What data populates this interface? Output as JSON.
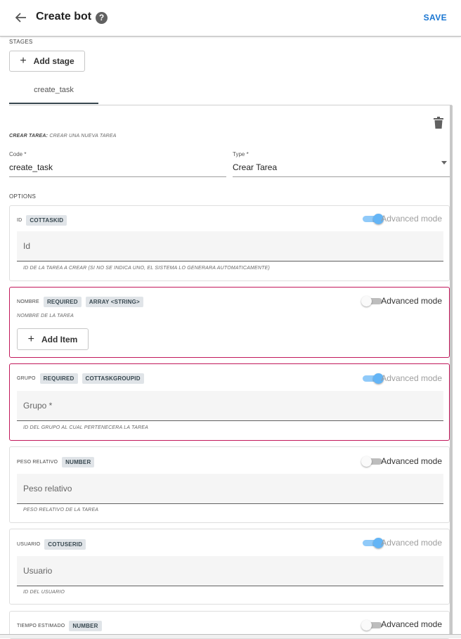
{
  "header": {
    "title": "Create bot",
    "help": "?",
    "save_label": "SAVE"
  },
  "stages": {
    "label": "STAGES",
    "add_label": "Add stage",
    "tabs": [
      "create_task"
    ]
  },
  "section": {
    "name": "CREAR TAREA:",
    "description": "CREAR UNA NUEVA TAREA"
  },
  "fields": {
    "code": {
      "label": "Code *",
      "value": "create_task"
    },
    "type": {
      "label": "Type *",
      "value": "Crear Tarea"
    }
  },
  "options": {
    "label": "OPTIONS",
    "advanced_label": "Advanced mode",
    "add_item_label": "Add Item",
    "items": [
      {
        "title": "ID",
        "chips": [
          "COTTASKID"
        ],
        "advanced": true,
        "placeholder": "Id",
        "hint": "ID DE LA TAREA A CREAR (SI NO SE INDICA UNO, EL SISTEMA LO GENERARA AUTOMATICAMENTE)"
      },
      {
        "title": "NOMBRE",
        "chips": [
          "REQUIRED",
          "ARRAY <STRING>"
        ],
        "advanced": false,
        "hint": "NOMBRE DE LA TAREA"
      },
      {
        "title": "GRUPO",
        "chips": [
          "REQUIRED",
          "COTTASKGROUPID"
        ],
        "advanced": true,
        "placeholder": "Grupo *",
        "hint": "ID DEL GRUPO AL CUAL PERTENECERA LA TAREA"
      },
      {
        "title": "PESO RELATIVO",
        "chips": [
          "NUMBER"
        ],
        "advanced": false,
        "placeholder": "Peso relativo",
        "hint": "PESO RELATIVO DE LA TAREA"
      },
      {
        "title": "USUARIO",
        "chips": [
          "COTUSERID"
        ],
        "advanced": true,
        "placeholder": "Usuario",
        "hint": "ID DEL USUARIO"
      },
      {
        "title": "TIEMPO ESTIMADO",
        "chips": [
          "NUMBER"
        ],
        "advanced": false
      }
    ]
  },
  "colors": {
    "accent": "#1976d2",
    "error": "#c2185b",
    "toggle_on": "#64b5f6"
  }
}
